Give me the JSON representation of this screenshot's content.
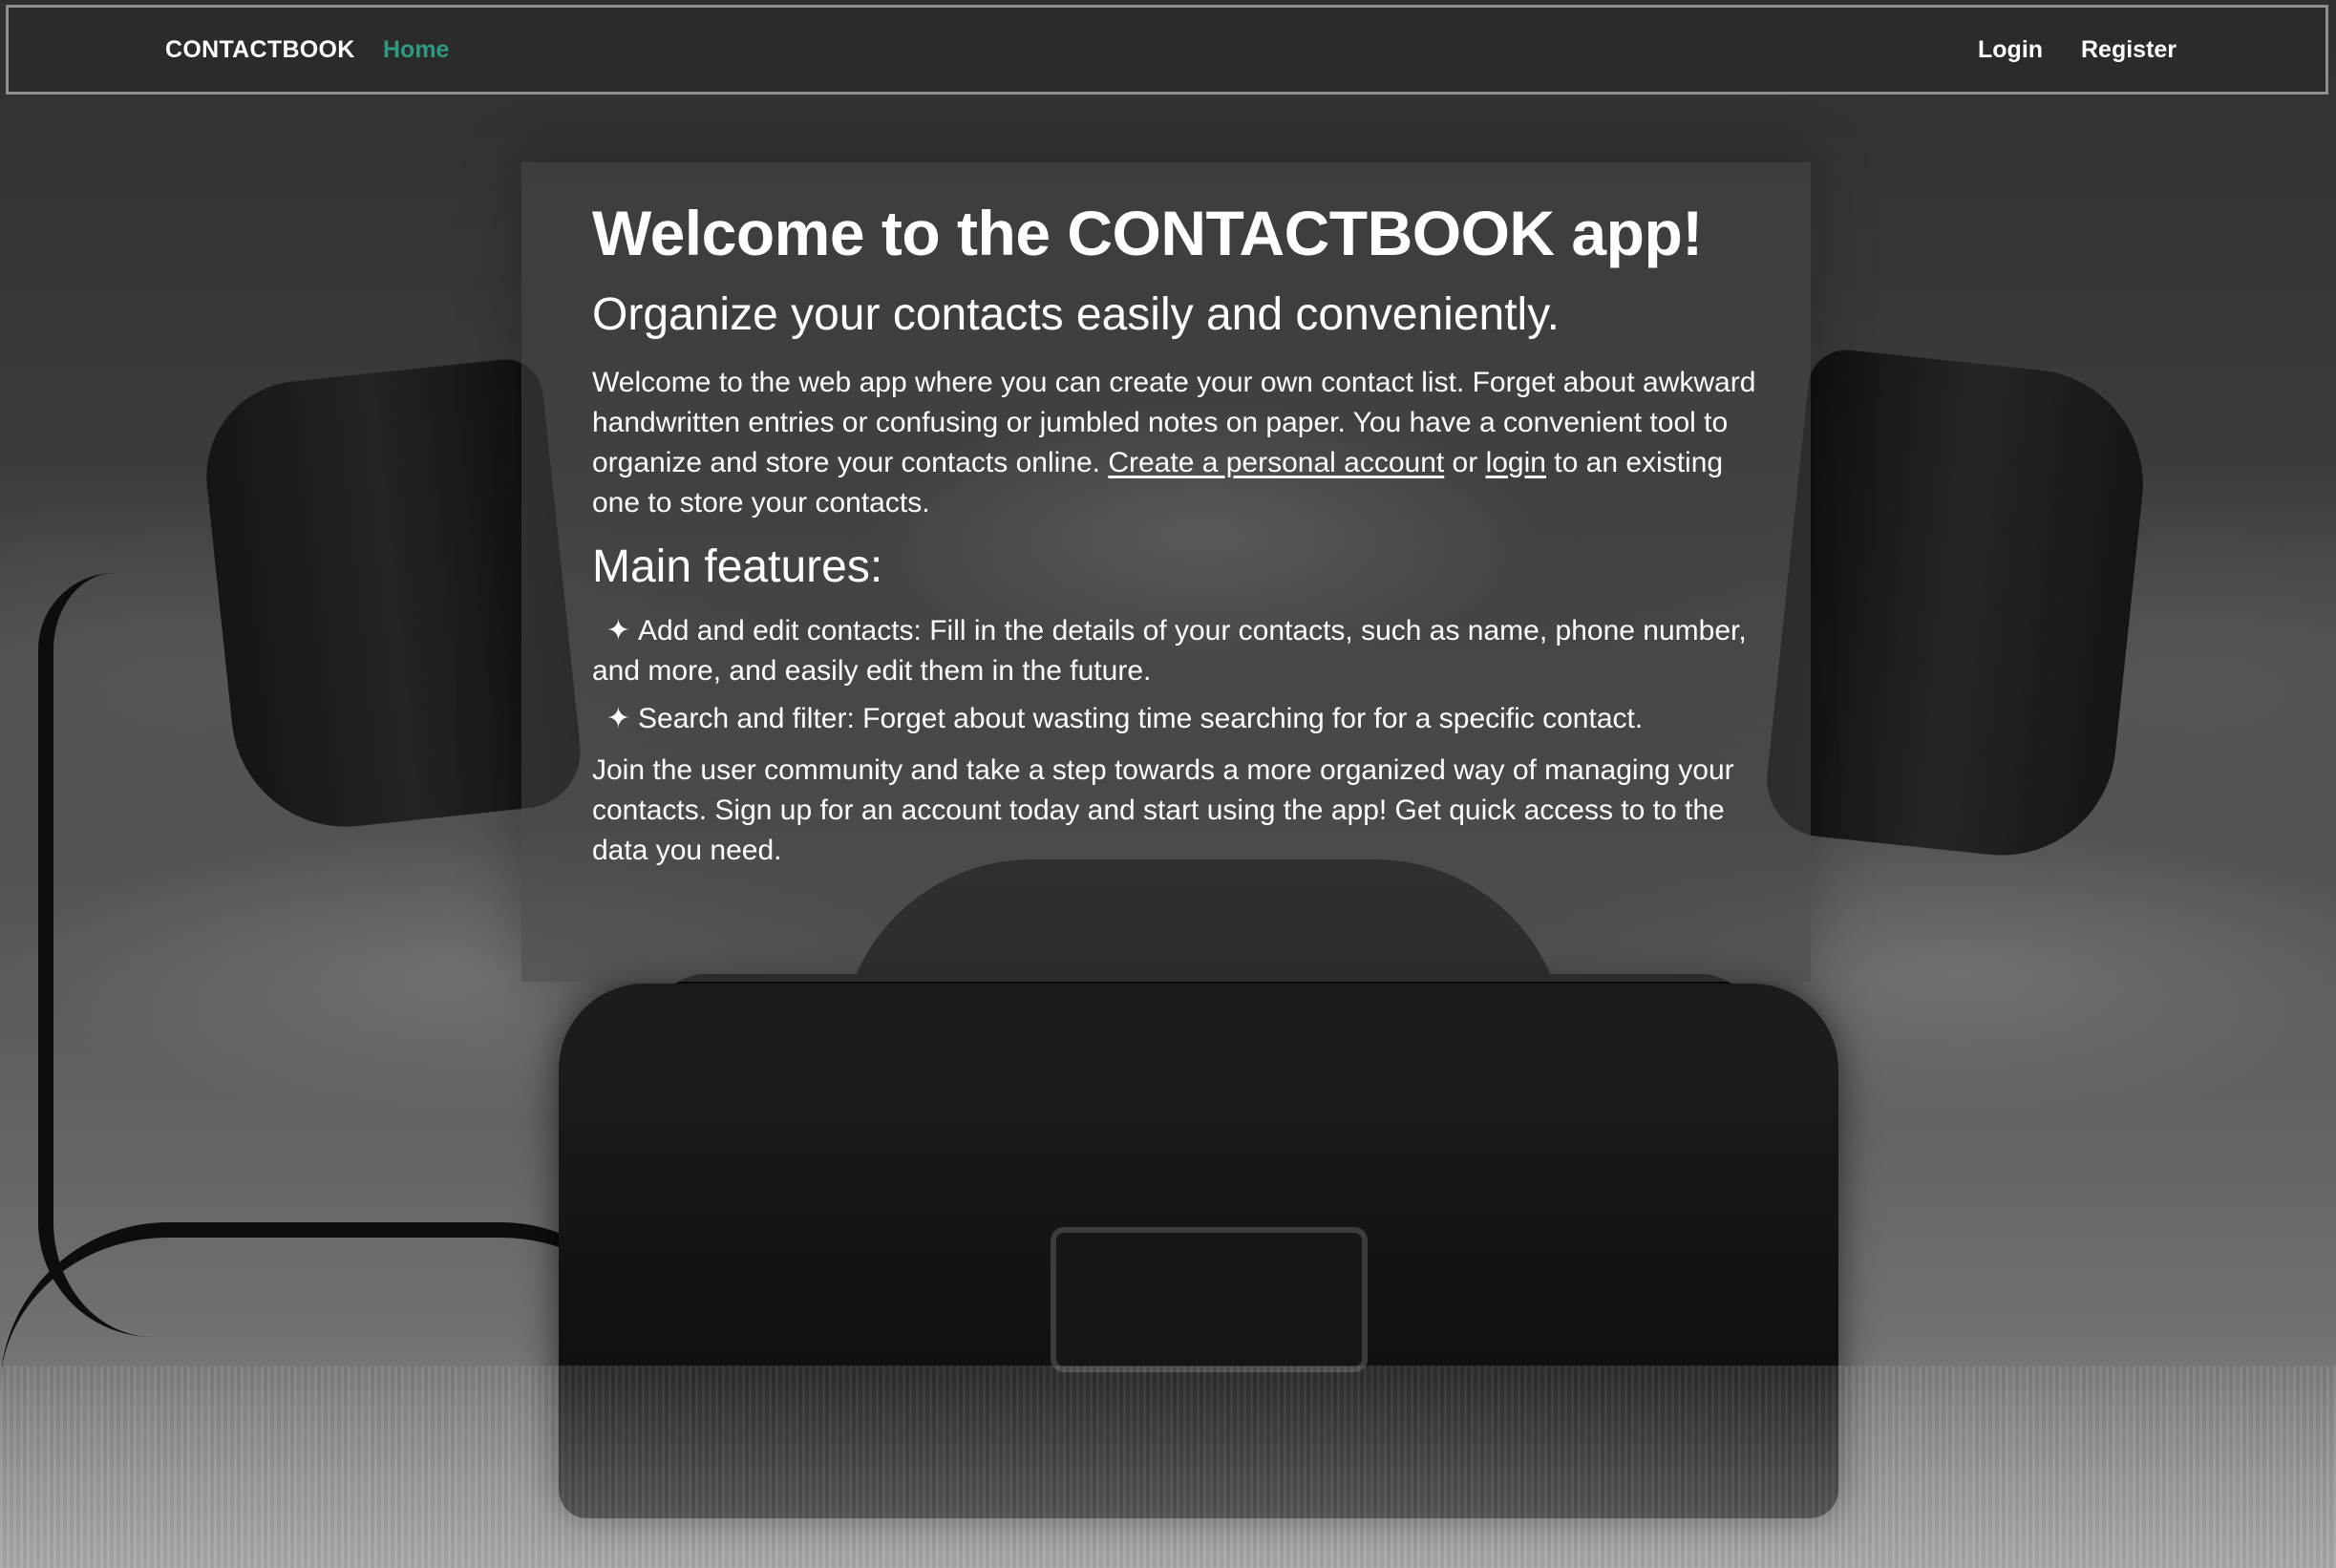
{
  "navbar": {
    "brand": "CONTACTBOOK",
    "home": "Home",
    "login": "Login",
    "register": "Register",
    "active_color": "#2f9a84"
  },
  "main": {
    "title": "Welcome to the CONTACTBOOK app!",
    "subtitle": "Organize your contacts easily and conveniently.",
    "intro": {
      "before_links": "Welcome to the web app where you can create your own contact list. Forget about awkward handwritten entries or confusing or jumbled notes on paper. You have a convenient tool to organize and store your contacts online. ",
      "create_account_link": "Create a personal account",
      "or_text": " or ",
      "login_link": "login",
      "after_links": " to an existing one to store your contacts."
    },
    "features_heading": "Main features:",
    "features": [
      {
        "icon": "✦",
        "text": "Add and edit contacts: Fill in the details of your contacts, such as name, phone number, and more, and easily edit them in the future."
      },
      {
        "icon": "✦",
        "text": "Search and filter: Forget about wasting time searching for for a specific contact."
      }
    ],
    "closing": "Join the user community and take a step towards a more organized way of managing your contacts. Sign up for an account today and start using the app! Get quick access to to the data you need."
  },
  "background": {
    "image": "vintage-rotary-telephone-photo"
  }
}
